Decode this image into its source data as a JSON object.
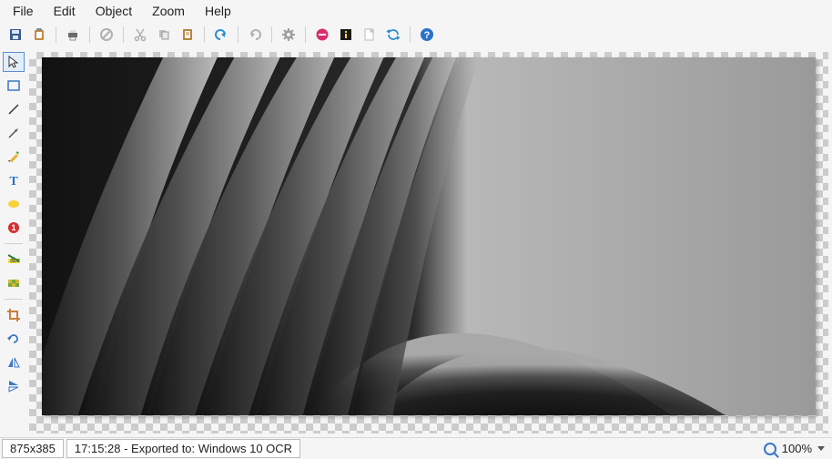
{
  "menu": {
    "file": "File",
    "edit": "Edit",
    "object": "Object",
    "zoom": "Zoom",
    "help": "Help"
  },
  "toolbar": {
    "save": "save-icon",
    "paste": "paste-icon",
    "print": "print-icon",
    "noentry": "noentry-icon",
    "cut": "cut-icon",
    "copy": "copy-icon",
    "clipboard": "clipboard-icon",
    "undo": "undo-icon",
    "redo": "redo-icon",
    "gear": "gear-icon",
    "stop": "stop-icon",
    "info": "info-icon",
    "new": "new-icon",
    "refresh": "refresh-icon",
    "help": "help-icon"
  },
  "sidetools": {
    "pointer": "pointer",
    "rectselect": "rectangle-select",
    "line": "line",
    "arrow": "arrow",
    "pencil": "pencil",
    "text": "text",
    "highlight": "highlight",
    "number": "number",
    "textmarker": "text-marker",
    "pixelate": "pixelate",
    "crop": "crop",
    "fliph": "flip-horizontal",
    "flipv": "flip-vertical"
  },
  "status": {
    "dimensions": "875x385",
    "message": "17:15:28 - Exported to: Windows 10 OCR",
    "zoom": "100%"
  }
}
